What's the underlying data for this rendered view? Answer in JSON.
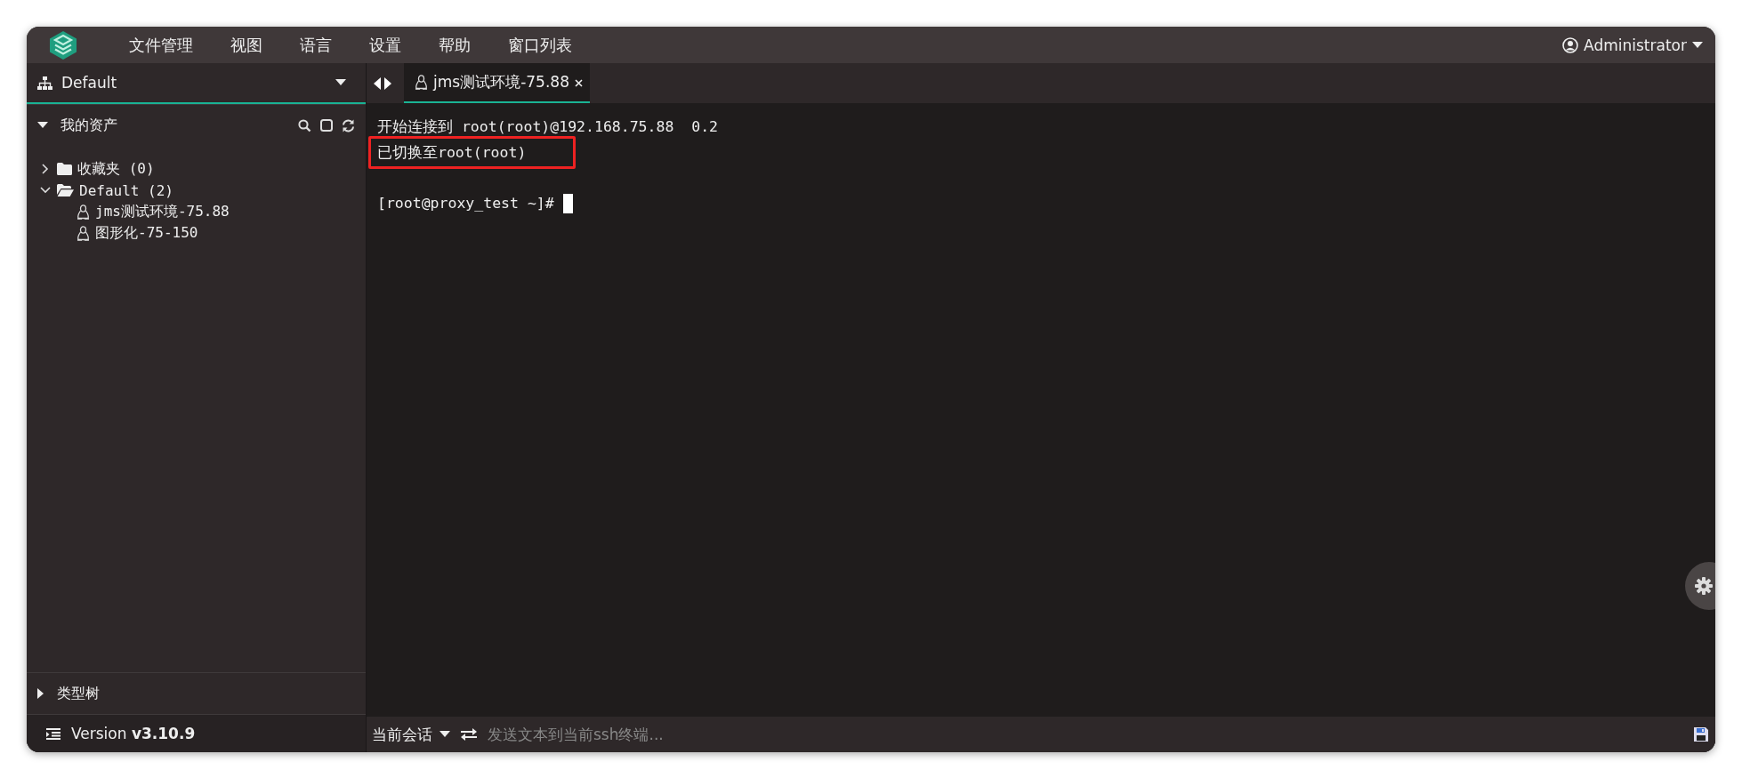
{
  "menubar": {
    "menus": [
      "文件管理",
      "视图",
      "语言",
      "设置",
      "帮助",
      "窗口列表"
    ],
    "user": "Administrator"
  },
  "sidebar": {
    "view_selector": "Default",
    "sections": [
      {
        "title": "我的资产",
        "expanded": true,
        "tree": [
          {
            "label": "收藏夹 (0)",
            "kind": "folder",
            "expanded": false
          },
          {
            "label": "Default (2)",
            "kind": "folder",
            "expanded": true,
            "children": [
              {
                "label": "jms测试环境-75.88",
                "kind": "host"
              },
              {
                "label": "图形化-75-150",
                "kind": "host"
              }
            ]
          }
        ]
      },
      {
        "title": "类型树",
        "expanded": false
      }
    ],
    "version": {
      "label": "Version",
      "number": "v3.10.9"
    }
  },
  "tabs": [
    {
      "label": "jms测试环境-75.88",
      "selected": true
    }
  ],
  "terminal": {
    "lines": [
      {
        "text": "开始连接到 root(root)@192.168.75.88  0.2",
        "highlighted": false
      },
      {
        "text": "已切换至root(root)",
        "highlighted": true
      }
    ],
    "prompt": "[root@proxy_test ~]#"
  },
  "footer": {
    "session_menu": "当前会话",
    "send_placeholder": "发送文本到当前ssh终端..."
  }
}
